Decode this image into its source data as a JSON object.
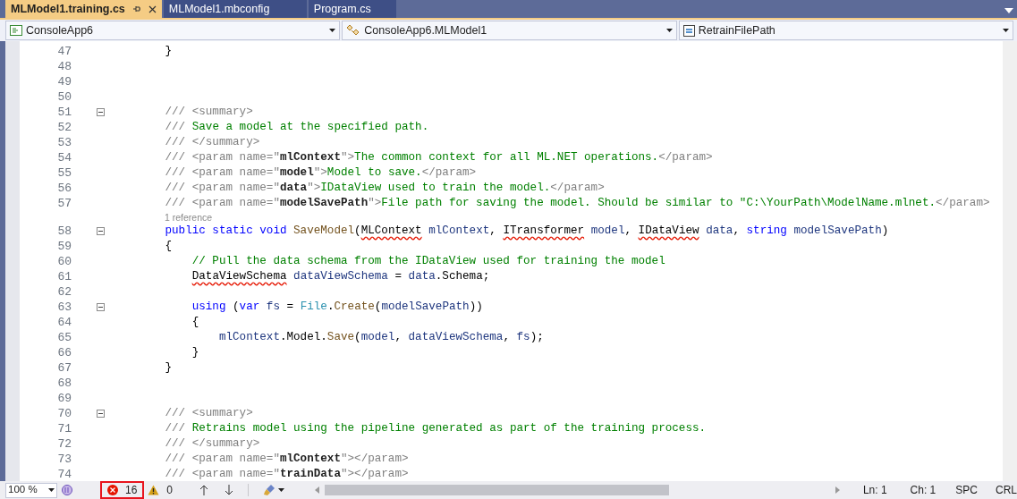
{
  "tabs": [
    {
      "label": "MLModel1.training.cs",
      "selected": true
    },
    {
      "label": "MLModel1.mbconfig",
      "selected": false
    },
    {
      "label": "Program.cs",
      "selected": false
    }
  ],
  "navigation_bar": {
    "project": "ConsoleApp6",
    "type": "ConsoleApp6.MLModel1",
    "member": "RetrainFilePath"
  },
  "editor": {
    "lines": [
      {
        "number": "47",
        "tokens": [
          {
            "text": "        }",
            "kind": "plain"
          }
        ]
      },
      {
        "number": "48"
      },
      {
        "number": "49"
      },
      {
        "number": "50"
      },
      {
        "number": "51",
        "foldable": true,
        "tokens": [
          {
            "text": "        /// <summary>",
            "kind": "doc"
          }
        ]
      },
      {
        "number": "52",
        "tokens": [
          {
            "text": "        /// ",
            "kind": "doc"
          },
          {
            "text": "Save a model at the specified path.",
            "kind": "doc_text"
          }
        ]
      },
      {
        "number": "53",
        "tokens": [
          {
            "text": "        /// </summary>",
            "kind": "doc"
          }
        ]
      },
      {
        "number": "54",
        "tokens": [
          {
            "text": "        /// <param name=\"",
            "kind": "doc"
          },
          {
            "text": "mlContext",
            "kind": "doc_attr"
          },
          {
            "text": "\">",
            "kind": "doc"
          },
          {
            "text": "The common context for all ML.NET operations.",
            "kind": "doc_text"
          },
          {
            "text": "</param>",
            "kind": "doc"
          }
        ]
      },
      {
        "number": "55",
        "tokens": [
          {
            "text": "        /// <param name=\"",
            "kind": "doc"
          },
          {
            "text": "model",
            "kind": "doc_attr"
          },
          {
            "text": "\">",
            "kind": "doc"
          },
          {
            "text": "Model to save.",
            "kind": "doc_text"
          },
          {
            "text": "</param>",
            "kind": "doc"
          }
        ]
      },
      {
        "number": "56",
        "tokens": [
          {
            "text": "        /// <param name=\"",
            "kind": "doc"
          },
          {
            "text": "data",
            "kind": "doc_attr"
          },
          {
            "text": "\">",
            "kind": "doc"
          },
          {
            "text": "IDataView used to train the model.",
            "kind": "doc_text"
          },
          {
            "text": "</param>",
            "kind": "doc"
          }
        ]
      },
      {
        "number": "57",
        "tokens": [
          {
            "text": "        /// <param name=\"",
            "kind": "doc"
          },
          {
            "text": "modelSavePath",
            "kind": "doc_attr"
          },
          {
            "text": "\">",
            "kind": "doc"
          },
          {
            "text": "File path for saving the model. Should be similar to \"C:\\YourPath\\ModelName.mlnet.",
            "kind": "doc_text"
          },
          {
            "text": "</param>",
            "kind": "doc"
          }
        ],
        "codelens": "1 reference"
      },
      {
        "number": "58",
        "foldable": true,
        "tokens": [
          {
            "text": "        public static void ",
            "kind": "keyword"
          },
          {
            "text": "SaveModel",
            "kind": "method"
          },
          {
            "text": "(",
            "kind": "plain"
          },
          {
            "text": "MLContext",
            "kind": "error"
          },
          {
            "text": " mlContext",
            "kind": "param"
          },
          {
            "text": ", ",
            "kind": "plain"
          },
          {
            "text": "ITransformer",
            "kind": "error"
          },
          {
            "text": " model",
            "kind": "param"
          },
          {
            "text": ", ",
            "kind": "plain"
          },
          {
            "text": "IDataView",
            "kind": "error"
          },
          {
            "text": " data",
            "kind": "param"
          },
          {
            "text": ", ",
            "kind": "plain"
          },
          {
            "text": "string",
            "kind": "keyword"
          },
          {
            "text": " modelSavePath",
            "kind": "param"
          },
          {
            "text": ")",
            "kind": "plain"
          }
        ]
      },
      {
        "number": "59",
        "tokens": [
          {
            "text": "        {",
            "kind": "plain"
          }
        ]
      },
      {
        "number": "60",
        "tokens": [
          {
            "text": "            // Pull the data schema from the IDataView used for training the model",
            "kind": "comment"
          }
        ]
      },
      {
        "number": "61",
        "tokens": [
          {
            "text": "            DataViewSchema",
            "kind": "error"
          },
          {
            "text": " dataViewSchema",
            "kind": "param"
          },
          {
            "text": " = ",
            "kind": "plain"
          },
          {
            "text": "data",
            "kind": "param"
          },
          {
            "text": ".Schema;",
            "kind": "plain"
          }
        ]
      },
      {
        "number": "62"
      },
      {
        "number": "63",
        "foldable": true,
        "tokens": [
          {
            "text": "            using",
            "kind": "keyword"
          },
          {
            "text": " (",
            "kind": "plain"
          },
          {
            "text": "var",
            "kind": "keyword"
          },
          {
            "text": " fs",
            "kind": "param"
          },
          {
            "text": " = ",
            "kind": "plain"
          },
          {
            "text": "File",
            "kind": "type"
          },
          {
            "text": ".",
            "kind": "plain"
          },
          {
            "text": "Create",
            "kind": "method"
          },
          {
            "text": "(",
            "kind": "plain"
          },
          {
            "text": "modelSavePath",
            "kind": "param"
          },
          {
            "text": "))",
            "kind": "plain"
          }
        ]
      },
      {
        "number": "64",
        "tokens": [
          {
            "text": "            {",
            "kind": "plain"
          }
        ]
      },
      {
        "number": "65",
        "tokens": [
          {
            "text": "                mlContext",
            "kind": "param"
          },
          {
            "text": ".Model.",
            "kind": "plain"
          },
          {
            "text": "Save",
            "kind": "method"
          },
          {
            "text": "(",
            "kind": "plain"
          },
          {
            "text": "model",
            "kind": "param"
          },
          {
            "text": ", ",
            "kind": "plain"
          },
          {
            "text": "dataViewSchema",
            "kind": "param"
          },
          {
            "text": ", ",
            "kind": "plain"
          },
          {
            "text": "fs",
            "kind": "param"
          },
          {
            "text": ");",
            "kind": "plain"
          }
        ]
      },
      {
        "number": "66",
        "tokens": [
          {
            "text": "            }",
            "kind": "plain"
          }
        ]
      },
      {
        "number": "67",
        "tokens": [
          {
            "text": "        }",
            "kind": "plain"
          }
        ]
      },
      {
        "number": "68"
      },
      {
        "number": "69"
      },
      {
        "number": "70",
        "foldable": true,
        "tokens": [
          {
            "text": "        /// <summary>",
            "kind": "doc"
          }
        ]
      },
      {
        "number": "71",
        "tokens": [
          {
            "text": "        /// ",
            "kind": "doc"
          },
          {
            "text": "Retrains model using the pipeline generated as part of the training process.",
            "kind": "doc_text"
          }
        ]
      },
      {
        "number": "72",
        "tokens": [
          {
            "text": "        /// </summary>",
            "kind": "doc"
          }
        ]
      },
      {
        "number": "73",
        "tokens": [
          {
            "text": "        /// <param name=\"",
            "kind": "doc"
          },
          {
            "text": "mlContext",
            "kind": "doc_attr"
          },
          {
            "text": "\"></param>",
            "kind": "doc"
          }
        ]
      },
      {
        "number": "74",
        "tokens": [
          {
            "text": "        /// <param name=\"",
            "kind": "doc"
          },
          {
            "text": "trainData",
            "kind": "doc_attr"
          },
          {
            "text": "\"></param>",
            "kind": "doc"
          }
        ]
      }
    ]
  },
  "status_bar": {
    "zoom": "100 %",
    "errors": {
      "count": "16",
      "highlighted": true
    },
    "warnings": "0",
    "line": "Ln: 1",
    "column": "Ch: 1",
    "whitespace": "SPC",
    "line_ending": "CRL"
  }
}
